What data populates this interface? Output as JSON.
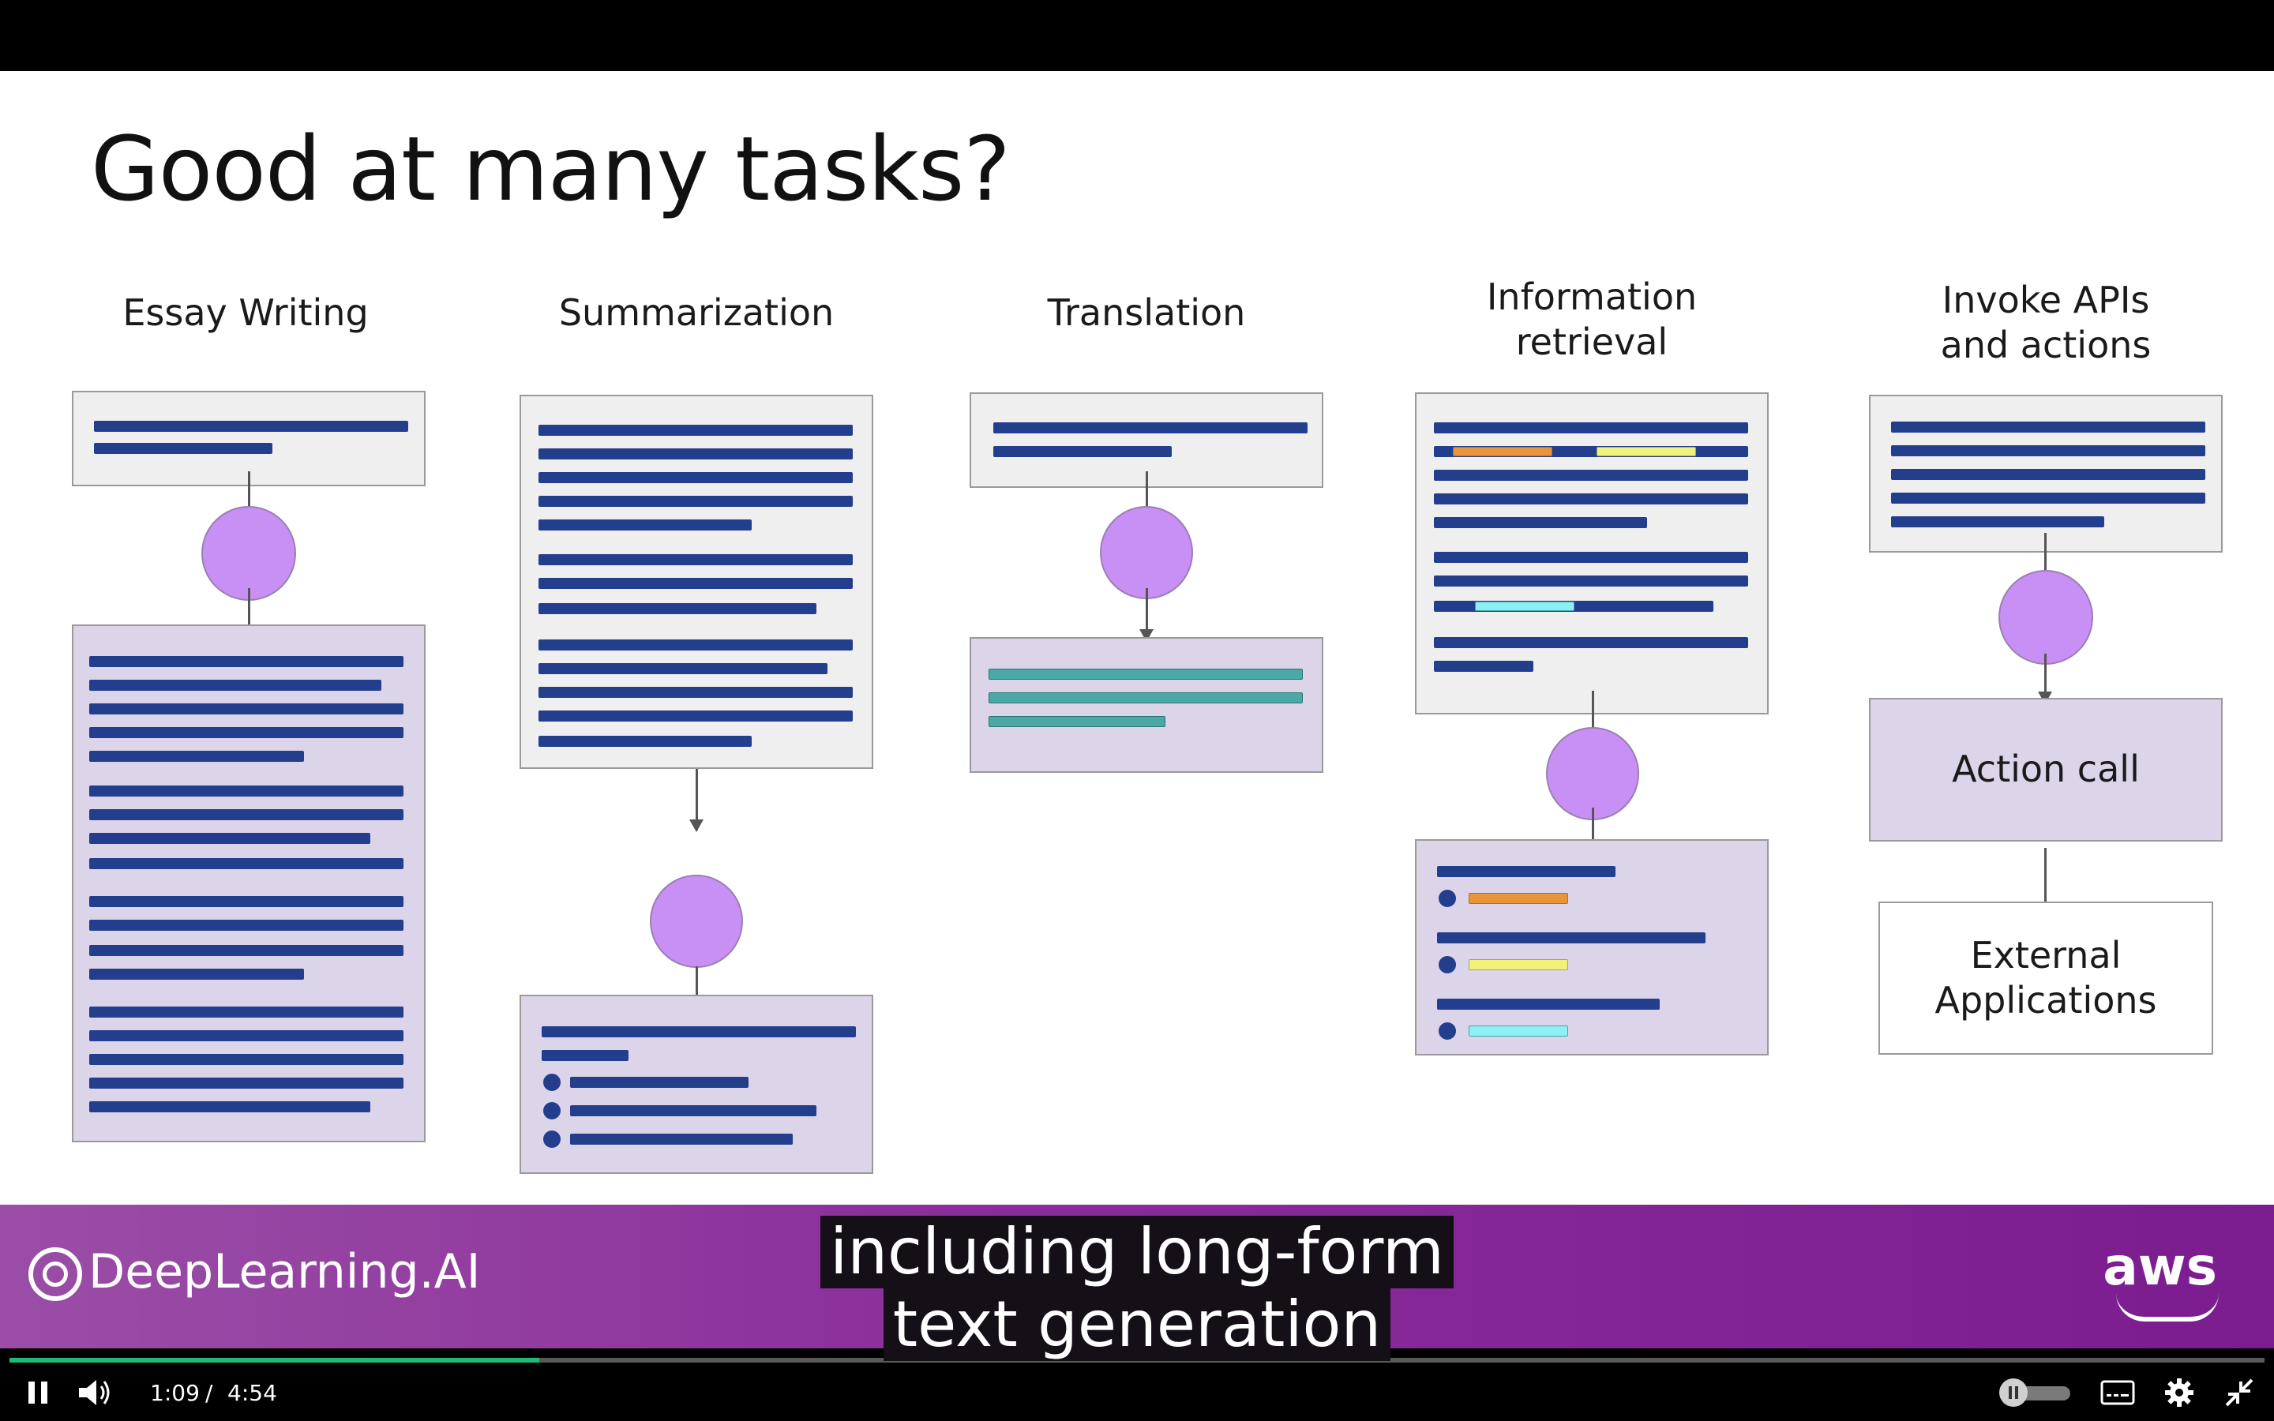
{
  "slide": {
    "title": "Good at many tasks?",
    "columns": [
      {
        "title": "Essay Writing"
      },
      {
        "title": "Summarization"
      },
      {
        "title": "Translation"
      },
      {
        "title_line1": "Information",
        "title_line2": "retrieval"
      },
      {
        "title_line1": "Invoke APIs",
        "title_line2": "and actions"
      }
    ],
    "action_call_label": "Action call",
    "external_apps_line1": "External",
    "external_apps_line2": "Applications"
  },
  "banner": {
    "brand": "DeepLearning.AI",
    "partner": "aws"
  },
  "captions": {
    "line1": "including long-form",
    "line2": "text generation"
  },
  "player": {
    "current_time": "1:09",
    "separator": "/",
    "duration": "4:54",
    "progress_fraction": 0.235,
    "icons": [
      "pause-icon",
      "volume-icon",
      "autoplay-toggle-icon",
      "subtitles-icon",
      "settings-gear-icon",
      "exit-fullscreen-icon"
    ],
    "accent_color": "#1fb978"
  }
}
